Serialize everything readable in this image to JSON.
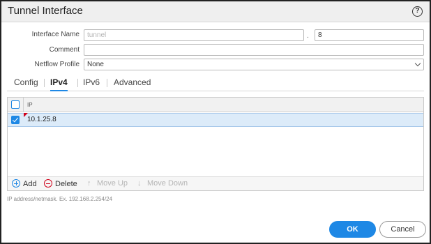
{
  "dialog": {
    "title": "Tunnel Interface",
    "help_glyph": "?"
  },
  "form": {
    "interface_name": {
      "label": "Interface Name",
      "value": "tunnel",
      "separator": ".",
      "suffix": "8"
    },
    "comment": {
      "label": "Comment",
      "value": ""
    },
    "netflow_profile": {
      "label": "Netflow Profile",
      "value": "None"
    }
  },
  "tabs": [
    {
      "label": "Config",
      "active": false
    },
    {
      "label": "IPv4",
      "active": true
    },
    {
      "label": "IPv6",
      "active": false
    },
    {
      "label": "Advanced",
      "active": false
    }
  ],
  "grid": {
    "column_header": "IP",
    "rows": [
      {
        "ip": "10.1.25.8",
        "checked": true
      }
    ]
  },
  "toolbar": {
    "add": "Add",
    "delete": "Delete",
    "move_up": "Move Up",
    "move_down": "Move Down",
    "move_up_glyph": "↑",
    "move_down_glyph": "↓"
  },
  "hint": "IP address/netmask. Ex. 192.168.2.254/24",
  "buttons": {
    "ok": "OK",
    "cancel": "Cancel"
  },
  "colors": {
    "accent": "#1e88e5",
    "dirty_flag": "#d0021b",
    "selected_row": "#dcebf9"
  },
  "icons": [
    "help-icon",
    "chevron-down-icon",
    "checkbox-icon",
    "add-icon",
    "delete-icon",
    "arrow-up-icon",
    "arrow-down-icon"
  ]
}
